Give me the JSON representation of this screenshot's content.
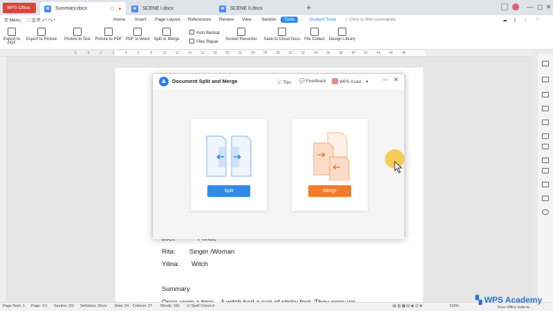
{
  "titlebar": {
    "wps_label": "WPS Office",
    "tabs": [
      "Summary.docx",
      "SCENE I.docx",
      "SCENE II.docx"
    ]
  },
  "menu": {
    "items": [
      "Home",
      "Insert",
      "Page Layout",
      "References",
      "Review",
      "View",
      "Section",
      "Tools",
      "Student Tools"
    ],
    "menu_icon_label": "Menu",
    "find": "Click to find commands"
  },
  "ribbon": {
    "buttons": [
      "Export to PDF",
      "Export to Picture",
      "Picture to Text",
      "Picture to PDF",
      "PDF to Word",
      "Split or Merge"
    ],
    "small": [
      "Auto Backup",
      "Files Repair"
    ],
    "buttons2": [
      "Screen Recorder",
      "Save to Cloud Docs",
      "File Collect",
      "Design Library"
    ]
  },
  "ruler": [
    "6",
    "4",
    "2",
    "2",
    "4",
    "6",
    "8",
    "10",
    "12",
    "14",
    "16",
    "18",
    "20",
    "22",
    "24",
    "26",
    "28",
    "30",
    "32",
    "34",
    "36",
    "38",
    "40",
    "42",
    "44",
    "46",
    "48"
  ],
  "document": {
    "lines": [
      {
        "label": "Joel:",
        "value": "Prince"
      },
      {
        "label": "Rita:",
        "value": "Singer /Woman"
      },
      {
        "label": "Yilina:",
        "value": "Witch"
      }
    ],
    "summary_heading": "Summary",
    "body_start": "Once upon a time... A witch had a pair of sticky feet. They were very"
  },
  "dialog": {
    "title": "Document Split and Merge",
    "tips": "Tips",
    "feedback": "Feedback",
    "account": "WPS Acad...",
    "split_label": "Split",
    "merge_label": "Merge",
    "colors": {
      "split": "#2f8be6",
      "merge": "#f07c2a"
    }
  },
  "status": {
    "page_num": "Page Num: 1",
    "page": "Page: 1/1",
    "section": "Section: 2/2",
    "setvalue": "SetValue: 26cm",
    "row": "Row: 24",
    "column": "Column: 37",
    "words": "Words: 181",
    "spell": "Spell Check",
    "zoom": "110%"
  },
  "brand": {
    "name": "WPS Academy",
    "tagline": "Free Office suite to..."
  }
}
